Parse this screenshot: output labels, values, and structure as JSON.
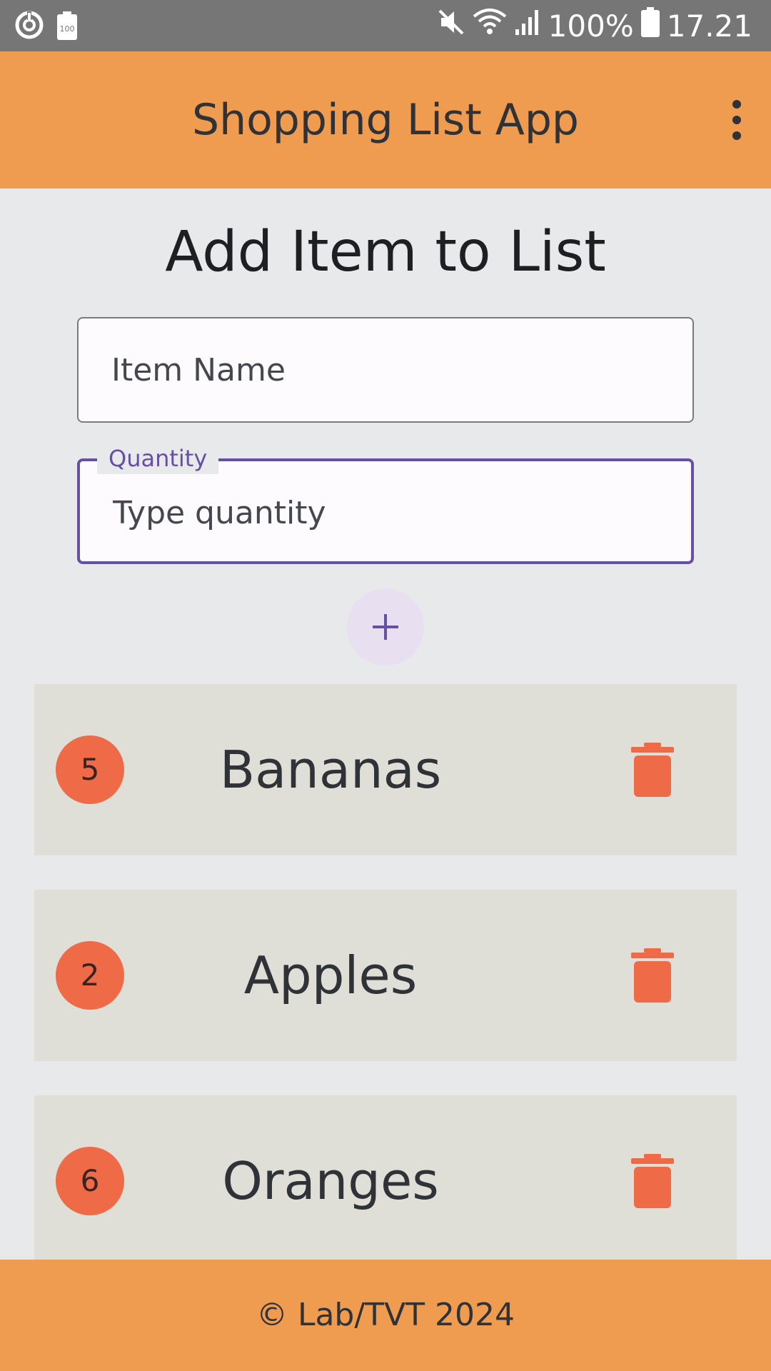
{
  "status_bar": {
    "battery_percent": "100%",
    "time": "17.21",
    "icons": [
      "sync-icon",
      "battery-saver-icon",
      "mute-icon",
      "wifi-icon",
      "signal-icon",
      "battery-icon"
    ]
  },
  "app_bar": {
    "title": "Shopping List App",
    "menu_icon": "more-vert-icon"
  },
  "form": {
    "heading": "Add Item to List",
    "item_name": {
      "placeholder": "Item Name",
      "value": ""
    },
    "quantity": {
      "label": "Quantity",
      "placeholder": "Type quantity",
      "value": ""
    },
    "add_icon": "plus-icon"
  },
  "items": [
    {
      "quantity": "5",
      "name": "Bananas"
    },
    {
      "quantity": "2",
      "name": "Apples"
    },
    {
      "quantity": "6",
      "name": "Oranges"
    }
  ],
  "footer": {
    "text": "© Lab/TVT 2024"
  },
  "colors": {
    "app_bar": "#f09c50",
    "accent": "#6750a4",
    "badge": "#ef6a47",
    "delete": "#ef6a47",
    "card": "#dfdfd8",
    "background": "#e8e9ea"
  }
}
